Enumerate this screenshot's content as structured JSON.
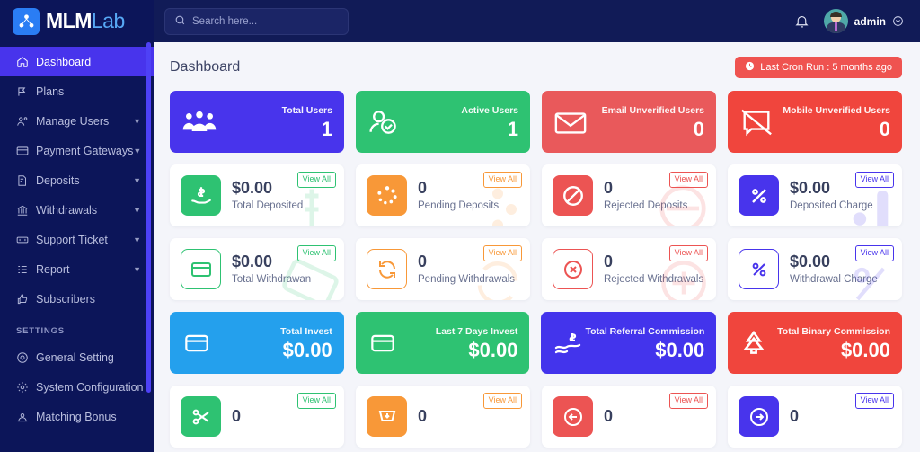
{
  "brand": {
    "name_primary": "MLM",
    "name_secondary": "Lab",
    "icon": "network-people-icon"
  },
  "sidebar": {
    "section_label": "SETTINGS",
    "items": [
      {
        "label": "Dashboard",
        "icon": "home-icon",
        "active": true,
        "caret": false
      },
      {
        "label": "Plans",
        "icon": "flag-icon",
        "active": false,
        "caret": false
      },
      {
        "label": "Manage Users",
        "icon": "users-gear-icon",
        "active": false,
        "caret": true
      },
      {
        "label": "Payment Gateways",
        "icon": "credit-card-icon",
        "active": false,
        "caret": true
      },
      {
        "label": "Deposits",
        "icon": "invoice-dollar-icon",
        "active": false,
        "caret": true
      },
      {
        "label": "Withdrawals",
        "icon": "bank-icon",
        "active": false,
        "caret": true
      },
      {
        "label": "Support Ticket",
        "icon": "ticket-icon",
        "active": false,
        "caret": true
      },
      {
        "label": "Report",
        "icon": "list-report-icon",
        "active": false,
        "caret": true
      },
      {
        "label": "Subscribers",
        "icon": "thumbs-up-icon",
        "active": false,
        "caret": false
      }
    ],
    "settings_items": [
      {
        "label": "General Setting",
        "icon": "gear-circle-icon",
        "caret": false
      },
      {
        "label": "System Configuration",
        "icon": "cog-icon",
        "caret": false
      },
      {
        "label": "Matching Bonus",
        "icon": "scale-user-icon",
        "caret": false
      }
    ]
  },
  "topbar": {
    "search_placeholder": "Search here...",
    "search_value": "",
    "notification_icon": "bell-icon",
    "username": "admin",
    "user_caret_icon": "chevron-down-circle-icon"
  },
  "page": {
    "title": "Dashboard",
    "cron_label": "Last Cron Run : 5 months ago",
    "cron_icon": "clock-icon",
    "cron_color": "#ef5350"
  },
  "view_all_label": "View All",
  "stat_cards": [
    {
      "label": "Total Users",
      "value": "1",
      "icon": "users-group-icon",
      "color": "#4834ec"
    },
    {
      "label": "Active Users",
      "value": "1",
      "icon": "user-check-icon",
      "color": "#2ec272"
    },
    {
      "label": "Email Unverified Users",
      "value": "0",
      "icon": "envelope-icon",
      "color": "#e9595b"
    },
    {
      "label": "Mobile Unverified Users",
      "value": "0",
      "icon": "mobile-slash-icon",
      "color": "#f0453d"
    }
  ],
  "deposit_cards": [
    {
      "label": "Total Deposited",
      "value": "$0.00",
      "icon": "hand-dollar-icon",
      "style": "filled",
      "color": "green"
    },
    {
      "label": "Pending Deposits",
      "value": "0",
      "icon": "spinner-icon",
      "style": "filled",
      "color": "orange"
    },
    {
      "label": "Rejected Deposits",
      "value": "0",
      "icon": "ban-icon",
      "style": "filled",
      "color": "red"
    },
    {
      "label": "Deposited Charge",
      "value": "$0.00",
      "icon": "percent-icon",
      "style": "filled",
      "color": "purple"
    }
  ],
  "withdraw_cards": [
    {
      "label": "Total Withdrawan",
      "value": "$0.00",
      "icon": "credit-card-icon",
      "style": "outline",
      "color": "green"
    },
    {
      "label": "Pending Withdrawals",
      "value": "0",
      "icon": "sync-icon",
      "style": "outline",
      "color": "orange"
    },
    {
      "label": "Rejected Withdrawals",
      "value": "0",
      "icon": "times-circle-icon",
      "style": "outline",
      "color": "red"
    },
    {
      "label": "Withdrawal Charge",
      "value": "$0.00",
      "icon": "percent-icon",
      "style": "outline",
      "color": "purple"
    }
  ],
  "invest_cards": [
    {
      "label": "Total Invest",
      "value": "$0.00",
      "icon": "card-icon",
      "color": "#24a0ed"
    },
    {
      "label": "Last 7 Days Invest",
      "value": "$0.00",
      "icon": "card-icon",
      "color": "#2ec272"
    },
    {
      "label": "Total Referral Commission",
      "value": "$0.00",
      "icon": "money-wave-icon",
      "color": "#4334ec"
    },
    {
      "label": "Total Binary Commission",
      "value": "$0.00",
      "icon": "tree-icon",
      "color": "#f0453d"
    }
  ],
  "bottom_cards": [
    {
      "value": "0",
      "icon": "scissors-icon",
      "color": "green"
    },
    {
      "value": "0",
      "icon": "cart-down-icon",
      "color": "orange"
    },
    {
      "value": "0",
      "icon": "arrow-left-icon",
      "color": "red"
    },
    {
      "value": "0",
      "icon": "arrow-right-icon",
      "color": "purple"
    }
  ]
}
